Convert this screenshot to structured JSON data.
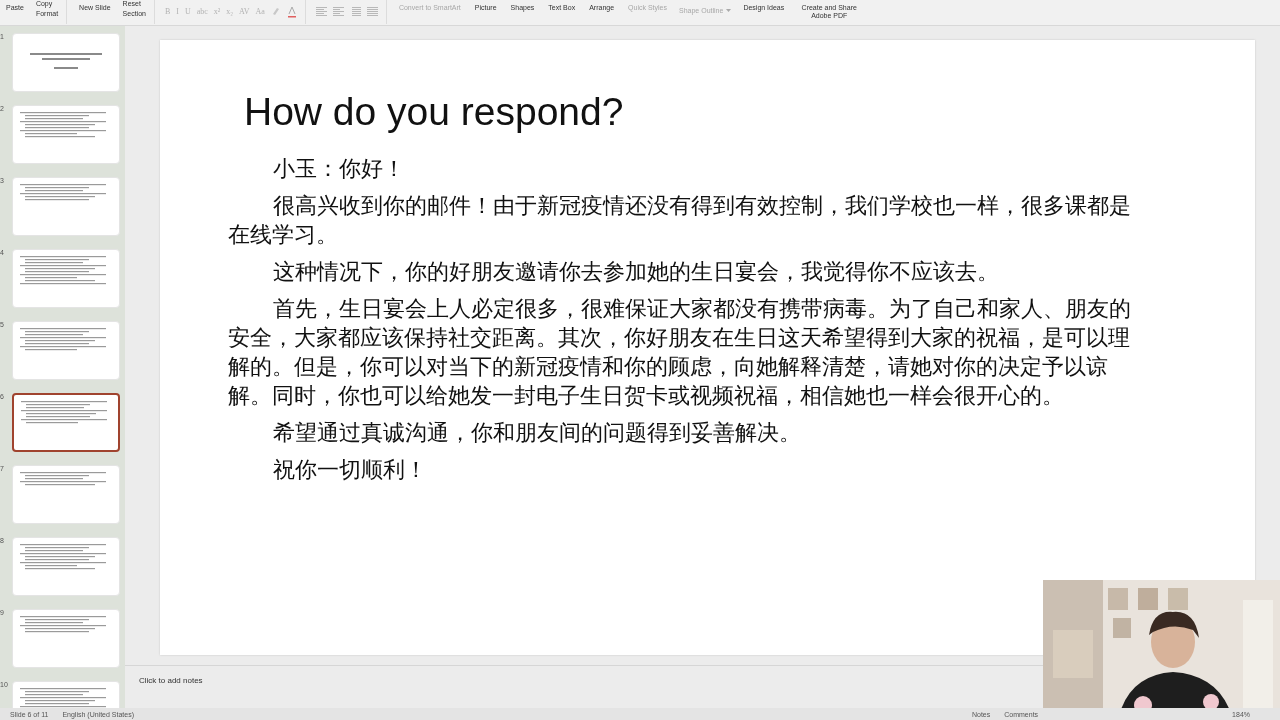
{
  "ribbon": {
    "groups": [
      {
        "kind": "big",
        "label": "Paste"
      },
      {
        "kind": "stack",
        "items": [
          "Copy",
          "Format"
        ]
      },
      {
        "kind": "big",
        "label": "New Slide"
      },
      {
        "kind": "stack",
        "items": [
          "Reset",
          "Section"
        ]
      },
      {
        "kind": "format",
        "items": [
          "B",
          "I",
          "U",
          "abc",
          "x²",
          "x₂",
          "AV",
          "Aa"
        ]
      },
      {
        "kind": "align"
      },
      {
        "kind": "big",
        "label": "Convert to SmartArt",
        "disabled": true
      },
      {
        "kind": "big",
        "label": "Picture"
      },
      {
        "kind": "big",
        "label": "Shapes"
      },
      {
        "kind": "big",
        "label": "Text Box"
      },
      {
        "kind": "big",
        "label": "Arrange"
      },
      {
        "kind": "big",
        "label": "Quick Styles",
        "disabled": true
      },
      {
        "kind": "inline",
        "label": "Shape Outline",
        "disabled": true
      },
      {
        "kind": "big",
        "label": "Design Ideas"
      },
      {
        "kind": "big",
        "label": "Create and Share Adobe PDF"
      }
    ]
  },
  "slides": [
    {
      "number": "1",
      "selected": false,
      "kind": "title"
    },
    {
      "number": "2",
      "selected": false,
      "kind": "content"
    },
    {
      "number": "3",
      "selected": false,
      "kind": "content"
    },
    {
      "number": "4",
      "selected": false,
      "kind": "content"
    },
    {
      "number": "5",
      "selected": false,
      "kind": "content"
    },
    {
      "number": "6",
      "selected": true,
      "kind": "content"
    },
    {
      "number": "7",
      "selected": false,
      "kind": "content"
    },
    {
      "number": "8",
      "selected": false,
      "kind": "content"
    },
    {
      "number": "9",
      "selected": false,
      "kind": "content"
    },
    {
      "number": "10",
      "selected": false,
      "kind": "content"
    }
  ],
  "slide": {
    "title": "How do you respond?",
    "paragraphs": [
      {
        "kind": "line",
        "text": "小玉：你好！"
      },
      {
        "kind": "para",
        "text": "很高兴收到你的邮件！由于新冠疫情还没有得到有效控制，我们学校也一样，很多课都是在线学习。"
      },
      {
        "kind": "para",
        "text": "这种情况下，你的好朋友邀请你去参加她的生日宴会，我觉得你不应该去。"
      },
      {
        "kind": "para",
        "text": "首先，生日宴会上人必定很多，很难保证大家都没有携带病毒。为了自己和家人、朋友的安全，大家都应该保持社交距离。其次，你好朋友在生日这天希望得到大家的祝福，是可以理解的。但是，你可以对当下的新冠疫情和你的顾虑，向她解释清楚，请她对你的决定予以谅解。同时，你也可以给她发一封电子生日贺卡或视频祝福，相信她也一样会很开心的。"
      },
      {
        "kind": "para",
        "text": "希望通过真诚沟通，你和朋友间的问题得到妥善解决。"
      },
      {
        "kind": "line",
        "text": "祝你一切顺利！"
      }
    ]
  },
  "notes": {
    "placeholder": "Click to add notes"
  },
  "status_bar": {
    "slide_info": "Slide 6 of 11",
    "language": "English (United States)",
    "notes": "Notes",
    "comments": "Comments",
    "zoom": "184%"
  }
}
